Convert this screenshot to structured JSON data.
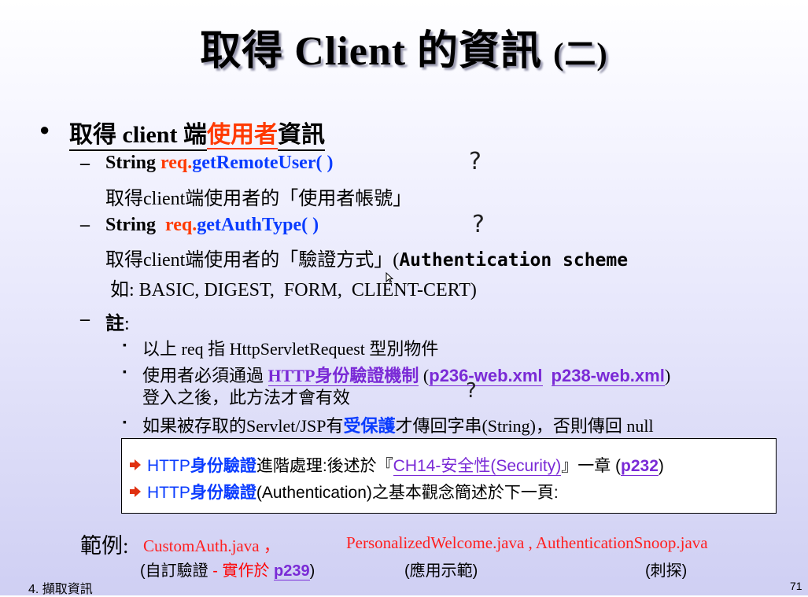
{
  "title": {
    "main": "取得 Client 的資訊",
    "paren": "(二)"
  },
  "l1": {
    "bullet": "●",
    "prefix": "取得 client 端",
    "highlight": "使用者",
    "suffix": "資訊"
  },
  "item1": {
    "dash": "–",
    "type": "String ",
    "obj": "req.",
    "method": "getRemoteUser( )",
    "desc": "取得client端使用者的「使用者帳號」"
  },
  "item2": {
    "dash": "–",
    "type": "String  ",
    "obj": "req.",
    "method": "getAuthType( )",
    "desc_prefix": "取得client端使用者的「驗證方式」(",
    "desc_mono": "Authentication scheme",
    "example": "如: BASIC, DIGEST,  FORM,  CLIENT-CERT)"
  },
  "item3": {
    "dash": "–",
    "label": "註",
    "colon": ":",
    "bullet": "▪",
    "sub1": "以上 req 指 HttpServletRequest 型別物件",
    "sub2_prefix": "使用者必須通過 ",
    "sub2_link": "HTTP身份驗證機制",
    "sub2_open": " (",
    "sub2_ref1": "p236-web.xml",
    "sub2_ref2": "p238-web.xml",
    "sub2_close": ")",
    "sub2_line2": "登入之後，此方法才會有效",
    "sub3_prefix": "如果被存取的Servlet/JSP有",
    "sub3_highlight": "受保護",
    "sub3_suffix": "才傳回字串(String)，否則傳回 null"
  },
  "qmark": "?",
  "note": {
    "line1_a": "HTTP",
    "line1_b": "身份驗證",
    "line1_c": "進階處理:後述於『",
    "line1_link": "CH14-安全性(Security)",
    "line1_d": "』一章 (",
    "line1_ref": "p232",
    "line1_e": ")",
    "line2_a": "HTTP",
    "line2_b": "身份驗證",
    "line2_c": "(Authentication)之基本觀念簡述於下一頁:"
  },
  "examples": {
    "label": "範例:",
    "file1": "CustomAuth.java ，",
    "file2": "PersonalizedWelcome.java , AuthenticationSnoop.java",
    "cap1_open": "(自訂驗證",
    "cap1_red": " - 實作於 ",
    "cap1_ref": "p239",
    "cap1_close": ")",
    "cap2": "(應用示範)",
    "cap3": "(刺探)"
  },
  "footer": {
    "chapter": "4. 擷取資訊",
    "page": "71"
  },
  "colors": {
    "orange": "#ff3a00",
    "blue": "#0a3cff",
    "red": "#ff0000",
    "purple": "#7a2ad6"
  }
}
